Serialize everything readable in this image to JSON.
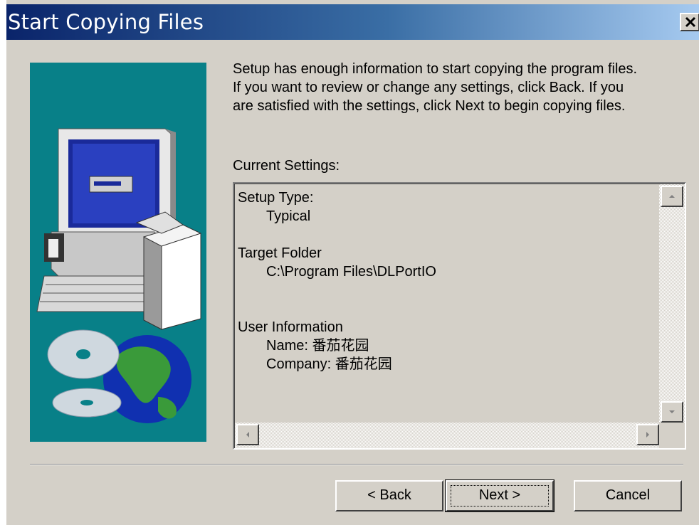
{
  "window": {
    "title": "Start Copying Files"
  },
  "intro": {
    "line1": "Setup has enough information to start copying the program files.",
    "line2": "If you want to review or change any settings, click Back.  If you",
    "line3": "are satisfied with the settings, click Next to begin copying files."
  },
  "current_settings_label": "Current Settings:",
  "settings_lines": [
    "Setup Type:",
    "Typical",
    "",
    "Target Folder",
    "C:\\Program Files\\DLPortIO",
    "",
    "",
    "User Information",
    "Name: 番茄花园",
    "Company: 番茄花园"
  ],
  "buttons": {
    "back": "< Back",
    "next": "Next >",
    "cancel": "Cancel"
  },
  "icons": [
    "close-icon",
    "computer-illustration",
    "scroll-up-icon",
    "scroll-down-icon",
    "scroll-left-icon",
    "scroll-right-icon"
  ],
  "colors": {
    "title_start": "#0a246a",
    "title_end": "#a6caf0",
    "dialog_bg": "#d4d0c8",
    "art_bg": "#088088"
  }
}
